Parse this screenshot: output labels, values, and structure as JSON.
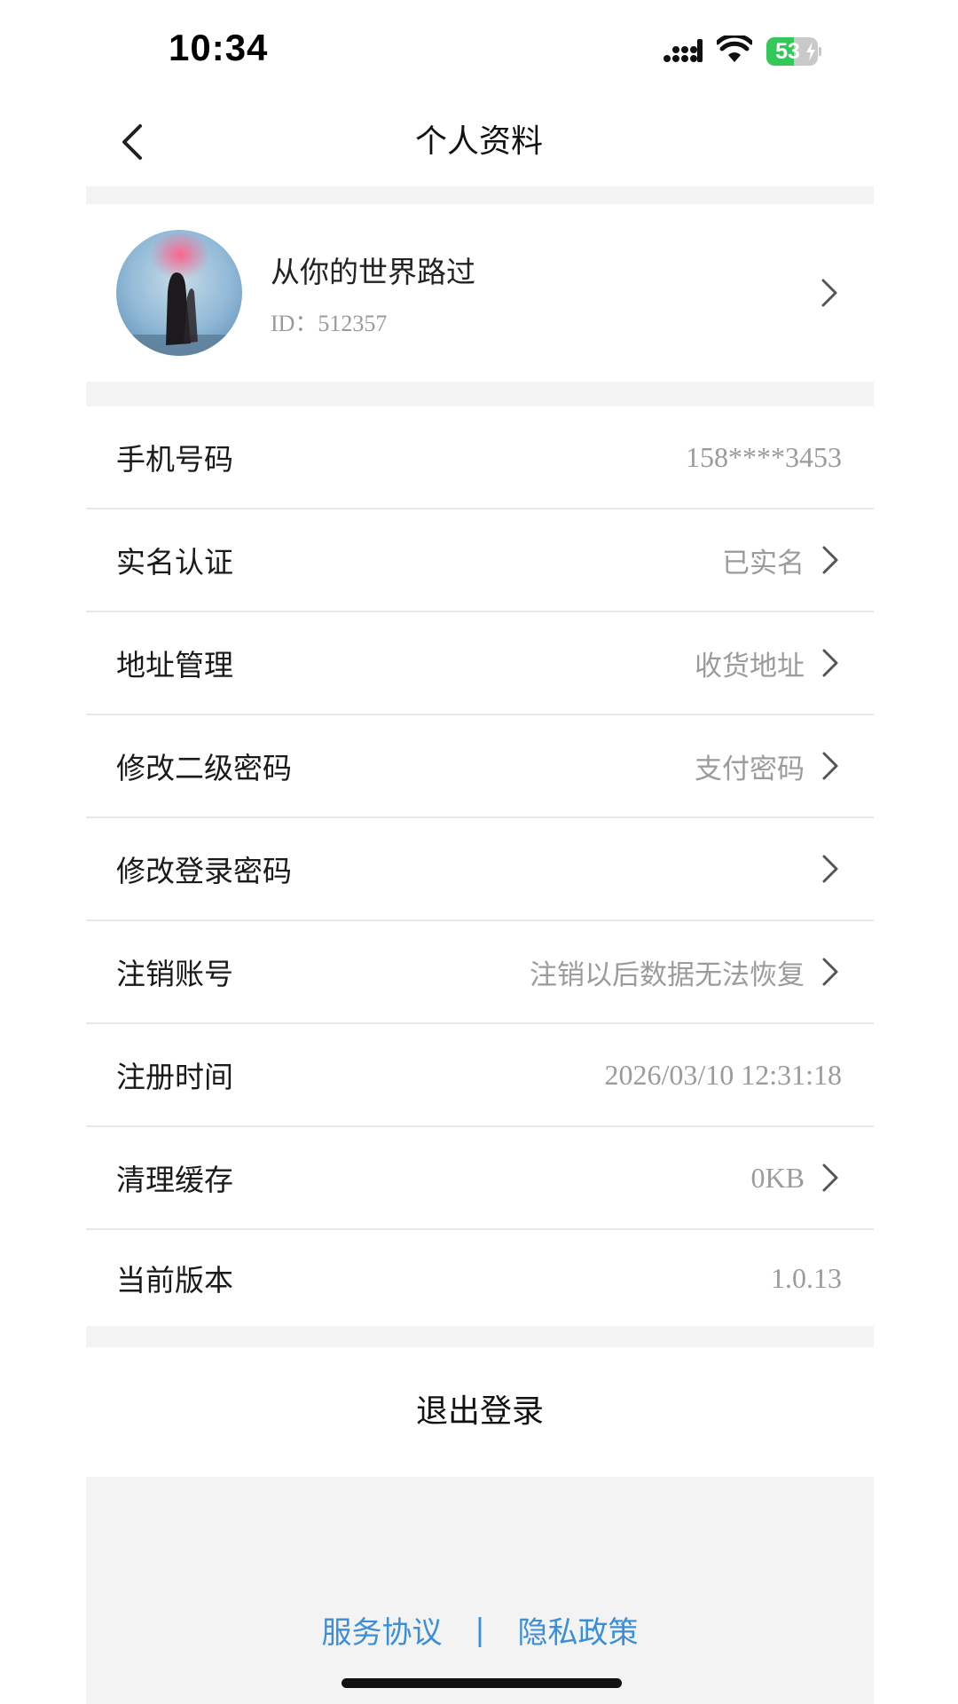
{
  "status_bar": {
    "time": "10:34",
    "battery_level": "53",
    "battery_fraction": 0.53,
    "battery_color": "#34c759",
    "icons": [
      "cellular-signal-icon",
      "wifi-icon",
      "battery-charging-icon"
    ]
  },
  "nav": {
    "title": "个人资料",
    "back_icon": "chevron-left-icon"
  },
  "profile": {
    "nickname": "从你的世界路过",
    "id_text": "ID：512357",
    "arrow_icon": "chevron-right-icon"
  },
  "settings": {
    "phone": {
      "label": "手机号码",
      "value": "158****3453"
    },
    "real_name": {
      "label": "实名认证",
      "value": "已实名"
    },
    "address": {
      "label": "地址管理",
      "value": "收货地址"
    },
    "secondary_password": {
      "label": "修改二级密码",
      "value": "支付密码"
    },
    "login_password": {
      "label": "修改登录密码",
      "value": ""
    },
    "cancel_account": {
      "label": "注销账号",
      "value": "注销以后数据无法恢复"
    },
    "register_time": {
      "label": "注册时间",
      "value": "2026/03/10 12:31:18"
    },
    "clear_cache": {
      "label": "清理缓存",
      "value": "0KB"
    },
    "version": {
      "label": "当前版本",
      "value": "1.0.13"
    }
  },
  "logout_label": "退出登录",
  "footer": {
    "service_agreement": "服务协议",
    "separator": "|",
    "privacy_policy": "隐私政策",
    "link_color": "#3b8fd8"
  }
}
